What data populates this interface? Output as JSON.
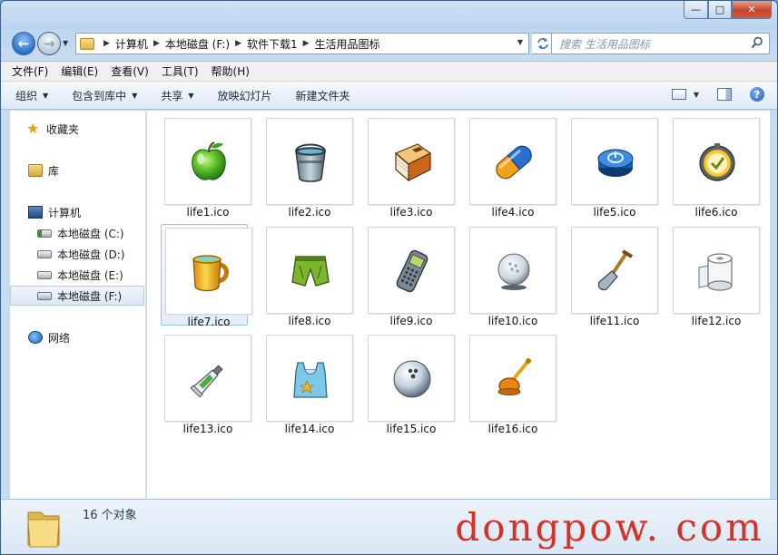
{
  "window": {
    "minimize_glyph": "—",
    "maximize_glyph": "□",
    "close_glyph": "✕"
  },
  "navigation": {
    "back_glyph": "←",
    "forward_glyph": "→"
  },
  "address_bar": {
    "breadcrumb": [
      "计算机",
      "本地磁盘 (F:)",
      "软件下载1",
      "生活用品图标"
    ]
  },
  "search": {
    "placeholder": "搜索 生活用品图标"
  },
  "menu": [
    "文件(F)",
    "编辑(E)",
    "查看(V)",
    "工具(T)",
    "帮助(H)"
  ],
  "toolbar": {
    "organize": "组织",
    "include_in_library": "包含到库中",
    "share": "共享",
    "slideshow": "放映幻灯片",
    "new_folder": "新建文件夹",
    "help_glyph": "?"
  },
  "sidebar": {
    "favorites": "收藏夹",
    "libraries": "库",
    "computer": "计算机",
    "drives": [
      "本地磁盘 (C:)",
      "本地磁盘 (D:)",
      "本地磁盘 (E:)",
      "本地磁盘 (F:)"
    ],
    "network": "网络"
  },
  "files": [
    {
      "name": "life1.ico",
      "icon": "green-apple-icon"
    },
    {
      "name": "life2.ico",
      "icon": "bucket-icon"
    },
    {
      "name": "life3.ico",
      "icon": "book-icon"
    },
    {
      "name": "life4.ico",
      "icon": "capsule-icon"
    },
    {
      "name": "life5.ico",
      "icon": "power-button-icon"
    },
    {
      "name": "life6.ico",
      "icon": "clock-icon"
    },
    {
      "name": "life7.ico",
      "icon": "mug-icon"
    },
    {
      "name": "life8.ico",
      "icon": "shorts-icon"
    },
    {
      "name": "life9.ico",
      "icon": "mobile-phone-icon"
    },
    {
      "name": "life10.ico",
      "icon": "golf-ball-icon"
    },
    {
      "name": "life11.ico",
      "icon": "shovel-icon"
    },
    {
      "name": "life12.ico",
      "icon": "toilet-paper-icon"
    },
    {
      "name": "life13.ico",
      "icon": "toothpaste-icon"
    },
    {
      "name": "life14.ico",
      "icon": "plastic-bag-icon"
    },
    {
      "name": "life15.ico",
      "icon": "bowling-ball-icon"
    },
    {
      "name": "life16.ico",
      "icon": "plunger-icon"
    }
  ],
  "details": {
    "count_text": "16 个对象"
  },
  "watermark": "dongpow. com",
  "colors": {
    "accent": "#2a6fc5",
    "selection": "#99c4ee",
    "watermark": "#d23228"
  }
}
